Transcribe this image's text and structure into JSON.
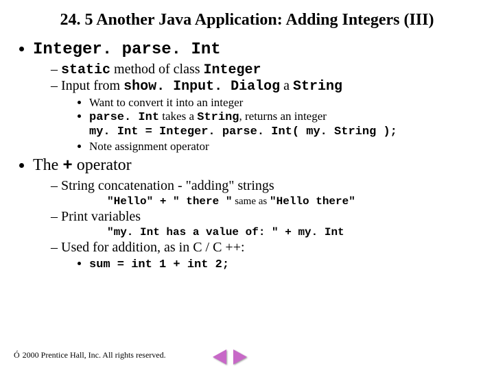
{
  "title": "24. 5  Another Java Application: Adding Integers (III)",
  "b1": "Integer. parse. Int",
  "b1s1_pre": "static",
  "b1s1_mid": " method of class ",
  "b1s1_post": "Integer",
  "b1s2_pre": "Input from ",
  "b1s2_mid": "show. Input. Dialog",
  "b1s2_mid2": " a ",
  "b1s2_post": "String",
  "b1s2c1": "Want to convert it into an integer",
  "b1s2c2_pre": "parse. Int",
  "b1s2c2_mid": " takes a ",
  "b1s2c2_mid2": "String",
  "b1s2c2_post": ", returns an integer",
  "b1s2c3": "my. Int = Integer. parse. Int( my. String );",
  "b1s2c4": "Note assignment operator",
  "b2_pre": "The ",
  "b2_mid": "+",
  "b2_post": " operator",
  "b2s1": "String concatenation - \"adding\" strings",
  "b2s1q_a": "\"Hello\" + \" there \"",
  "b2s1q_mid": " same as ",
  "b2s1q_b": "\"Hello there\"",
  "b2s2": "Print variables",
  "b2s2q": "\"my. Int has a value of: \" + my. Int",
  "b2s3": "Used for addition, as in C / C ++:",
  "b2s3c1": "sum = int 1 + int 2;",
  "copyright": "2000 Prentice Hall, Inc.  All rights reserved.",
  "copy_symbol": "Ó"
}
